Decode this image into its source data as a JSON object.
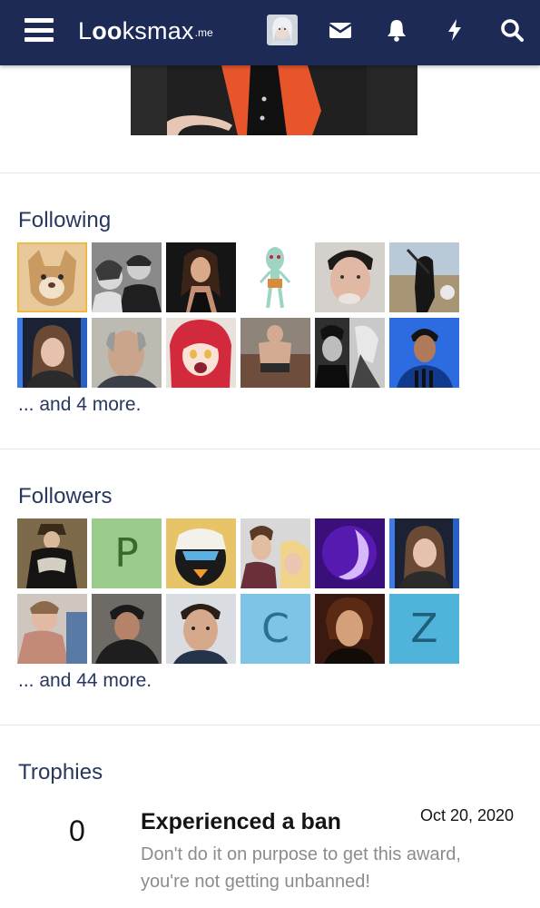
{
  "header": {
    "logo_main": "Lᴏᴏksmax",
    "logo_tld": ".me",
    "icons": [
      "menu-icon",
      "user-avatar",
      "envelope-icon",
      "bell-icon",
      "bolt-icon",
      "search-icon"
    ],
    "background": "#1c2a55"
  },
  "following": {
    "title": "Following",
    "more": "... and 4 more."
  },
  "followers": {
    "title": "Followers",
    "more": "... and 44 more.",
    "letters": [
      "P",
      "C",
      "Z"
    ],
    "letter_colors": {
      "P": "#9ccc8c",
      "C": "#7ec4e6",
      "Z": "#4fb3da"
    }
  },
  "trophies": {
    "title": "Trophies",
    "items": [
      {
        "points": "0",
        "title": "Experienced a ban",
        "date": "Oct 20, 2020",
        "description": "Don't do it on purpose to get this award, you're not getting unbanned!"
      }
    ]
  },
  "colors": {
    "accent": "#27375e",
    "muted": "#8c8c8c",
    "highlight_border": "#f0b429"
  }
}
